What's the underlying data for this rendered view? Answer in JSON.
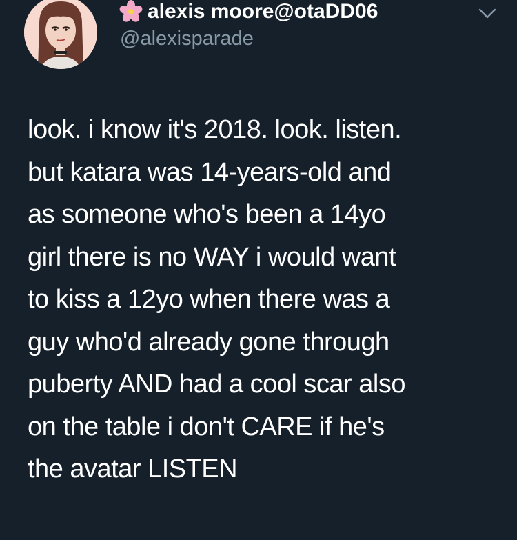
{
  "tweet": {
    "author": {
      "display_name": "alexis moore@otaDD06",
      "handle": "@alexisparade",
      "avatar_icon": "cartoon-avatar-icon",
      "name_prefix_icon": "flower-icon"
    },
    "menu_icon": "chevron-down-icon",
    "text_lines": [
      "look. i know it's 2018. look. listen.",
      "but katara was 14-years-old and",
      "as someone who's been a 14yo",
      "girl there is no WAY i would want",
      "to kiss a 12yo when there was a",
      "guy who'd already gone through",
      "puberty AND had a cool scar also",
      "on the table i don't CARE if he's",
      "the avatar LISTEN"
    ]
  },
  "colors": {
    "background": "#15202b",
    "text_primary": "#ffffff",
    "text_secondary": "#8899a6",
    "flower_pink": "#f4a9c8"
  }
}
